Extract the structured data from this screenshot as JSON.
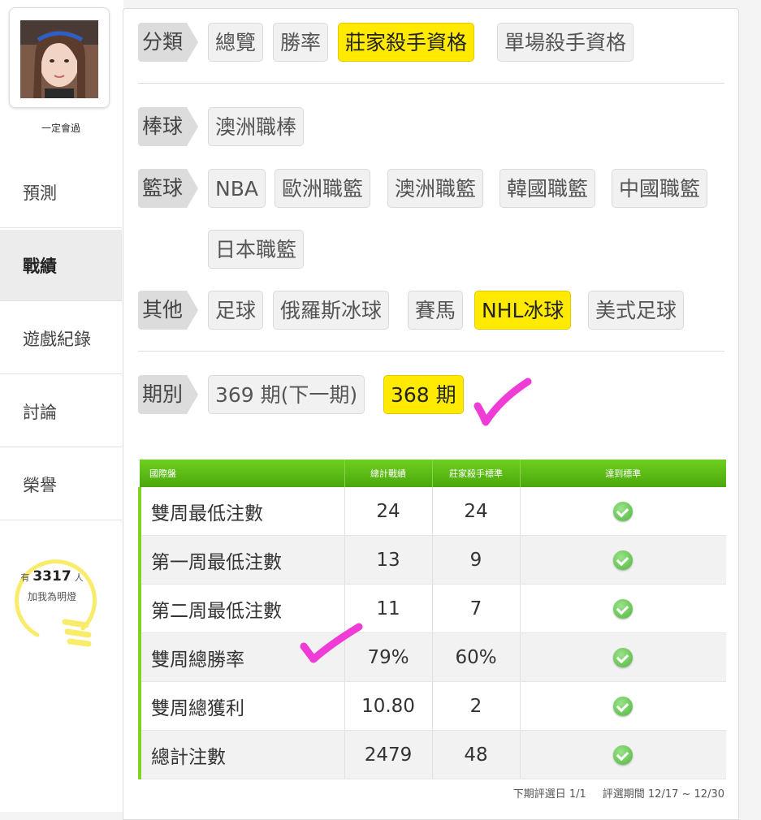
{
  "user": {
    "name": "一定會過"
  },
  "nav": {
    "items": [
      {
        "label": "預測"
      },
      {
        "label": "戰績"
      },
      {
        "label": "遊戲紀錄"
      },
      {
        "label": "討論"
      },
      {
        "label": "榮譽"
      }
    ],
    "active": "戰績"
  },
  "fans": {
    "prefix": "有",
    "count": "3317",
    "suffix": "人",
    "cta": "加我為明燈"
  },
  "filters": {
    "category": {
      "label": "分類",
      "options": [
        "總覽",
        "勝率",
        "莊家殺手資格",
        "單場殺手資格"
      ],
      "selected": "莊家殺手資格"
    },
    "baseball": {
      "label": "棒球",
      "options": [
        "澳洲職棒"
      ]
    },
    "basketball": {
      "label": "籃球",
      "options": [
        "NBA",
        "歐洲職籃",
        "澳洲職籃",
        "韓國職籃",
        "中國職籃",
        "日本職籃"
      ]
    },
    "other": {
      "label": "其他",
      "options": [
        "足球",
        "俄羅斯冰球",
        "賽馬",
        "NHL冰球",
        "美式足球"
      ],
      "selected": "NHL冰球"
    },
    "period": {
      "label": "期別",
      "options": [
        "369 期(下一期)",
        "368 期"
      ],
      "selected": "368 期"
    }
  },
  "table": {
    "headers": [
      "國際盤",
      "總計戰績",
      "莊家殺手標準",
      "達到標準"
    ],
    "rows": [
      {
        "item": "雙周最低注數",
        "total": "24",
        "standard": "24",
        "met": true
      },
      {
        "item": "第一周最低注數",
        "total": "13",
        "standard": "9",
        "met": true
      },
      {
        "item": "第二周最低注數",
        "total": "11",
        "standard": "7",
        "met": true
      },
      {
        "item": "雙周總勝率",
        "total": "79%",
        "standard": "60%",
        "met": true
      },
      {
        "item": "雙周總獲利",
        "total": "10.80",
        "standard": "2",
        "met": true
      },
      {
        "item": "總計注數",
        "total": "2479",
        "standard": "48",
        "met": true
      }
    ]
  },
  "footer": {
    "next_eval": "下期評選日 1/1",
    "eval_period": "評選期間 12/17 ~ 12/30"
  },
  "colors": {
    "active_chip": "#ffea00",
    "table_header": "#5cbd14",
    "check": "#4fb63c",
    "annotation": "#f03cd6"
  }
}
